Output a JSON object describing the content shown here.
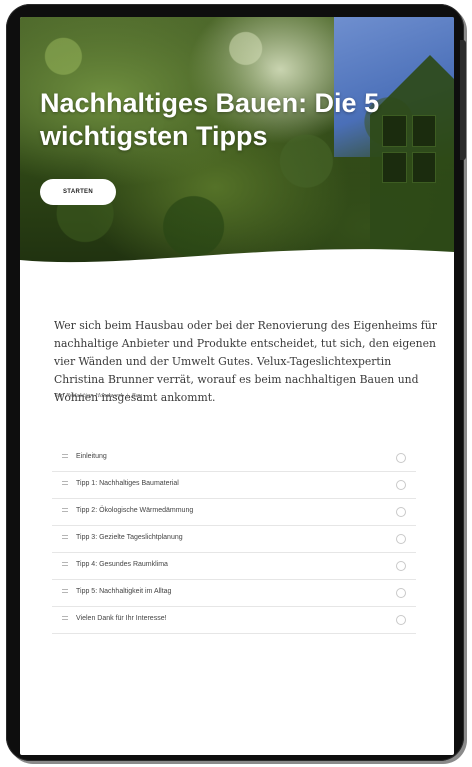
{
  "hero": {
    "title": "Nachhaltiges Bauen: Die 5 wichtigsten Tipps",
    "start_label": "STARTEN"
  },
  "intro": {
    "text": "Wer sich beim Hausbau oder bei der Renovierung des Eigenheims für nachhaltige Anbieter und Produkte entscheidet, tut sich, den eigenen vier Wänden und der Umwelt Gutes. Velux-Tageslichtexpertin Christina Brunner verrät, worauf es beim nachhaltigen Bauen und Wohnen insgesamt ankommt.",
    "byline": "Von Redaktion Handwerk + Bau"
  },
  "lessons": [
    {
      "label": "Einleitung"
    },
    {
      "label": "Tipp 1: Nachhaltiges Baumaterial"
    },
    {
      "label": "Tipp 2: Ökologische Wärmedämmung"
    },
    {
      "label": "Tipp 3: Gezielte Tageslichtplanung"
    },
    {
      "label": "Tipp 4: Gesundes Raumklima"
    },
    {
      "label": "Tipp 5: Nachhaltigkeit im Alltag"
    },
    {
      "label": "Vielen Dank für Ihr Interesse!"
    }
  ],
  "colors": {
    "frame": "#0e0e0e",
    "accent_text": "#3a3a3a",
    "divider": "#e6e6e6"
  }
}
